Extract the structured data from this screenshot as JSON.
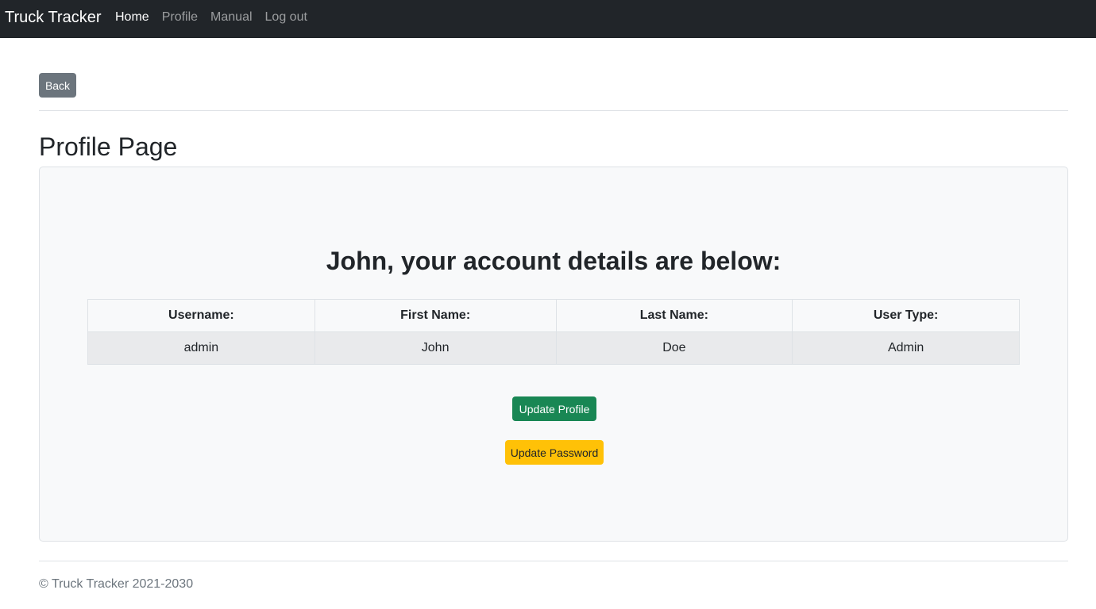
{
  "navbar": {
    "brand": "Truck Tracker",
    "links": [
      {
        "label": "Home",
        "active": true
      },
      {
        "label": "Profile",
        "active": false
      },
      {
        "label": "Manual",
        "active": false
      },
      {
        "label": "Log out",
        "active": false
      }
    ]
  },
  "back_button": "Back",
  "page_title": "Profile Page",
  "card": {
    "heading": "John, your account details are below:",
    "table": {
      "headers": [
        "Username:",
        "First Name:",
        "Last Name:",
        "User Type:"
      ],
      "rows": [
        [
          "admin",
          "John",
          "Doe",
          "Admin"
        ]
      ]
    },
    "update_profile_button": "Update Profile",
    "update_password_button": "Update Password"
  },
  "footer": "© Truck Tracker 2021-2030",
  "colors": {
    "navbar_bg": "#212529",
    "back_button": "#6c757d",
    "update_profile": "#198754",
    "update_password": "#ffc107"
  }
}
